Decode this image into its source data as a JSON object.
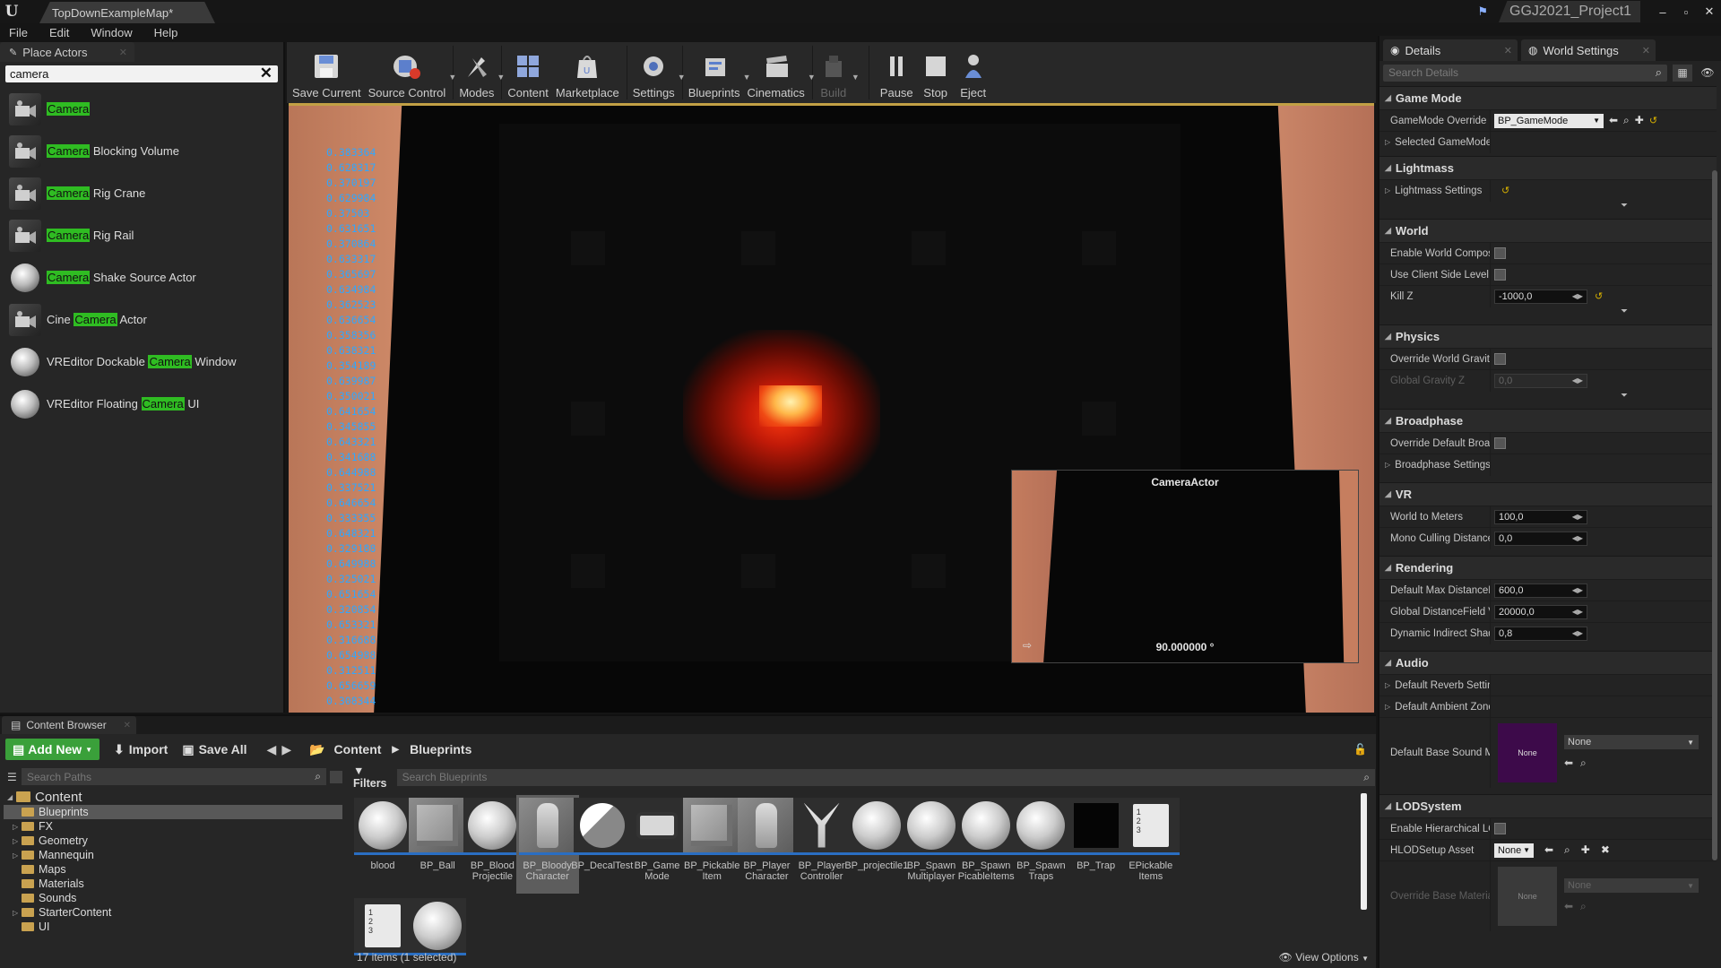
{
  "title_bar": {
    "logo": "U",
    "tab": "TopDownExampleMap*",
    "project": "GGJ2021_Project1",
    "window_buttons": [
      "–",
      "▫",
      "✕"
    ]
  },
  "menu": [
    "File",
    "Edit",
    "Window",
    "Help"
  ],
  "place_actors": {
    "tab_label": "Place Actors",
    "search_value": "camera",
    "items": [
      {
        "pre": "",
        "hl": "Camera",
        "post": "",
        "thumb": "camera"
      },
      {
        "pre": "",
        "hl": "Camera",
        "post": " Blocking Volume",
        "thumb": "camera"
      },
      {
        "pre": "",
        "hl": "Camera",
        "post": " Rig Crane",
        "thumb": "camera"
      },
      {
        "pre": "",
        "hl": "Camera",
        "post": " Rig Rail",
        "thumb": "camera"
      },
      {
        "pre": "",
        "hl": "Camera",
        "post": " Shake Source Actor",
        "thumb": "sphere"
      },
      {
        "pre": "Cine ",
        "hl": "Camera",
        "post": " Actor",
        "thumb": "camera"
      },
      {
        "pre": "VREditor Dockable ",
        "hl": "Camera",
        "post": " Window",
        "thumb": "sphere"
      },
      {
        "pre": "VREditor Floating ",
        "hl": "Camera",
        "post": " UI",
        "thumb": "sphere"
      }
    ]
  },
  "toolbar": {
    "save_current": "Save Current",
    "source_control": "Source Control",
    "modes": "Modes",
    "content": "Content",
    "marketplace": "Marketplace",
    "settings": "Settings",
    "blueprints": "Blueprints",
    "cinematics": "Cinematics",
    "build": "Build",
    "pause": "Pause",
    "stop": "Stop",
    "eject": "Eject"
  },
  "viewport": {
    "stat_values": [
      "0.383364",
      "0.628317",
      "0.370197",
      "0.629984",
      "0.37503",
      "0.631651",
      "0.370864",
      "0.633317",
      "0.365697",
      "0.634984",
      "0.362523",
      "0.636654",
      "0.358356",
      "0.638321",
      "0.354189",
      "0.639987",
      "0.350021",
      "0.641654",
      "0.345855",
      "0.643321",
      "0.341688",
      "0.644988",
      "0.337521",
      "0.646654",
      "0.333355",
      "0.648321",
      "0.329188",
      "0.649988",
      "0.325021",
      "0.651654",
      "0.320854",
      "0.653321",
      "0.316688",
      "0.654988",
      "0.312511",
      "0.656659",
      "0.308344"
    ],
    "preview_title": "CameraActor",
    "preview_fov": "90.000000 °"
  },
  "details": {
    "tab_details": "Details",
    "tab_world_settings": "World Settings",
    "search_placeholder": "Search Details",
    "game_mode": {
      "title": "Game Mode",
      "gamemode_override_label": "GameMode Override",
      "gamemode_override_value": "BP_GameMode",
      "selected_gamemode_label": "Selected GameMode"
    },
    "lightmass": {
      "title": "Lightmass",
      "settings_label": "Lightmass Settings"
    },
    "world": {
      "title": "World",
      "enable_world_composition": "Enable World Composi",
      "use_client_side_level": "Use Client Side Level S",
      "kill_z_label": "Kill Z",
      "kill_z_value": "-1000,0"
    },
    "physics": {
      "title": "Physics",
      "override_world_gravity": "Override World Gravity",
      "global_gravity_z_label": "Global Gravity Z",
      "global_gravity_z_value": "0,0"
    },
    "broadphase": {
      "title": "Broadphase",
      "override_default": "Override Default Broad",
      "settings_label": "Broadphase Settings"
    },
    "vr": {
      "title": "VR",
      "world_to_meters_label": "World to Meters",
      "world_to_meters_value": "100,0",
      "mono_culling_label": "Mono Culling Distance",
      "mono_culling_value": "0,0"
    },
    "rendering": {
      "title": "Rendering",
      "default_max_distance_label": "Default Max DistanceF",
      "default_max_distance_value": "600,0",
      "global_distancefield_label": "Global DistanceField V",
      "global_distancefield_value": "20000,0",
      "dynamic_indirect_label": "Dynamic Indirect Shad",
      "dynamic_indirect_value": "0,8"
    },
    "audio": {
      "title": "Audio",
      "default_reverb_label": "Default Reverb Setting",
      "default_ambient_label": "Default Ambient Zone",
      "default_base_sound_label": "Default Base Sound M",
      "sound_thumb": "None",
      "sound_value": "None"
    },
    "lodsystem": {
      "title": "LODSystem",
      "enable_hierarchical": "Enable Hierarchical LO",
      "hlod_setup_label": "HLODSetup Asset",
      "hlod_setup_value": "None",
      "override_base_material_label": "Override Base Materia",
      "material_thumb": "None",
      "material_value": "None"
    }
  },
  "content_browser": {
    "tab_label": "Content Browser",
    "add_new": "Add New",
    "import": "Import",
    "save_all": "Save All",
    "breadcrumb": [
      "Content",
      "Blueprints"
    ],
    "search_paths_placeholder": "Search Paths",
    "filters": "Filters",
    "search_blueprints_placeholder": "Search Blueprints",
    "tree_root": "Content",
    "tree_items": [
      {
        "label": "Blueprints",
        "selected": true,
        "expandable": false
      },
      {
        "label": "FX",
        "selected": false,
        "expandable": true
      },
      {
        "label": "Geometry",
        "selected": false,
        "expandable": true
      },
      {
        "label": "Mannequin",
        "selected": false,
        "expandable": true
      },
      {
        "label": "Maps",
        "selected": false,
        "expandable": false
      },
      {
        "label": "Materials",
        "selected": false,
        "expandable": false
      },
      {
        "label": "Sounds",
        "selected": false,
        "expandable": false
      },
      {
        "label": "StarterContent",
        "selected": false,
        "expandable": true
      },
      {
        "label": "UI",
        "selected": false,
        "expandable": false
      }
    ],
    "assets": [
      {
        "label": "blood",
        "kind": "ball",
        "selected": false
      },
      {
        "label": "BP_Ball",
        "kind": "cube",
        "selected": false
      },
      {
        "label": "BP_Blood Projectile",
        "kind": "ball",
        "selected": false
      },
      {
        "label": "BP_Bloody Character",
        "kind": "figure",
        "selected": true
      },
      {
        "label": "BP_DecalTest",
        "kind": "moon",
        "selected": false
      },
      {
        "label": "BP_Game Mode",
        "kind": "pad",
        "selected": false
      },
      {
        "label": "BP_Pickable Item",
        "kind": "cube",
        "selected": false
      },
      {
        "label": "BP_Player Character",
        "kind": "figure",
        "selected": false
      },
      {
        "label": "BP_Player Controller",
        "kind": "ctrl",
        "selected": false
      },
      {
        "label": "BP_projectile1",
        "kind": "ball",
        "selected": false
      },
      {
        "label": "BP_Spawn Multiplayer",
        "kind": "ball",
        "selected": false
      },
      {
        "label": "BP_Spawn PicableItems",
        "kind": "ball",
        "selected": false
      },
      {
        "label": "BP_Spawn Traps",
        "kind": "ball",
        "selected": false
      },
      {
        "label": "BP_Trap",
        "kind": "black",
        "selected": false
      },
      {
        "label": "EPickable Items",
        "kind": "doc",
        "selected": false
      },
      {
        "label": "",
        "kind": "doc",
        "selected": false
      },
      {
        "label": "",
        "kind": "ball",
        "selected": false
      }
    ],
    "doc_glyph": "1\n2\n3",
    "status": "17 items (1 selected)",
    "view_options": "View Options"
  }
}
